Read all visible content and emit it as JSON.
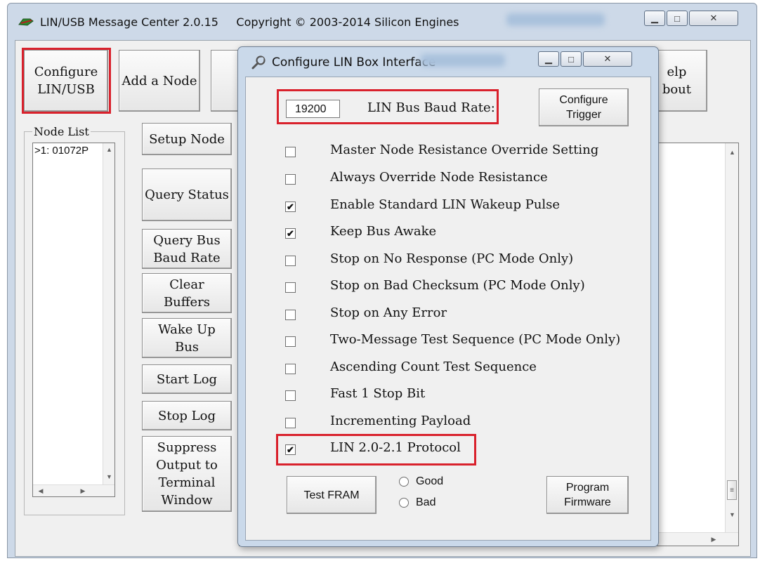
{
  "window": {
    "title": "LIN/USB Message Center 2.0.15     Copyright © 2003-2014 Silicon Engines"
  },
  "toolbar": {
    "configure": "Configure\nLIN/USB",
    "add_node": "Add a Node",
    "help_about_partial": "elp\nbout"
  },
  "node_list": {
    "label": "Node List",
    "items": [
      ">1: 01072P"
    ]
  },
  "side_buttons": {
    "setup_node": "Setup Node",
    "query_status": "Query Status",
    "query_bus_baud": "Query Bus\nBaud Rate",
    "clear_buffers": "Clear\nBuffers",
    "wake_up_bus": "Wake Up\nBus",
    "start_log": "Start Log",
    "stop_log": "Stop Log",
    "suppress_output": "Suppress\nOutput to\nTerminal\nWindow"
  },
  "dialog": {
    "title": "Configure LIN Box Interface",
    "baud_value": "19200",
    "baud_label": "LIN Bus Baud Rate:",
    "configure_trigger": "Configure\nTrigger",
    "options": [
      {
        "label": "Master Node Resistance Override Setting",
        "checked": false
      },
      {
        "label": "Always Override Node Resistance",
        "checked": false
      },
      {
        "label": "Enable Standard LIN Wakeup Pulse",
        "checked": true
      },
      {
        "label": "Keep Bus Awake",
        "checked": true
      },
      {
        "label": "Stop on No Response (PC Mode Only)",
        "checked": false
      },
      {
        "label": "Stop on Bad Checksum (PC Mode Only)",
        "checked": false
      },
      {
        "label": "Stop on Any Error",
        "checked": false
      },
      {
        "label": "Two-Message Test Sequence (PC Mode Only)",
        "checked": false
      },
      {
        "label": "Ascending Count Test Sequence",
        "checked": false
      },
      {
        "label": "Fast 1 Stop Bit",
        "checked": false
      },
      {
        "label": "Incrementing Payload",
        "checked": false
      },
      {
        "label": "LIN 2.0-2.1 Protocol",
        "checked": true
      }
    ],
    "test_fram": "Test FRAM",
    "radio_good": "Good",
    "radio_bad": "Bad",
    "program_firmware": "Program\nFirmware"
  },
  "colors": {
    "highlight": "#d9212c",
    "title_bar": "#cdd9e8"
  }
}
